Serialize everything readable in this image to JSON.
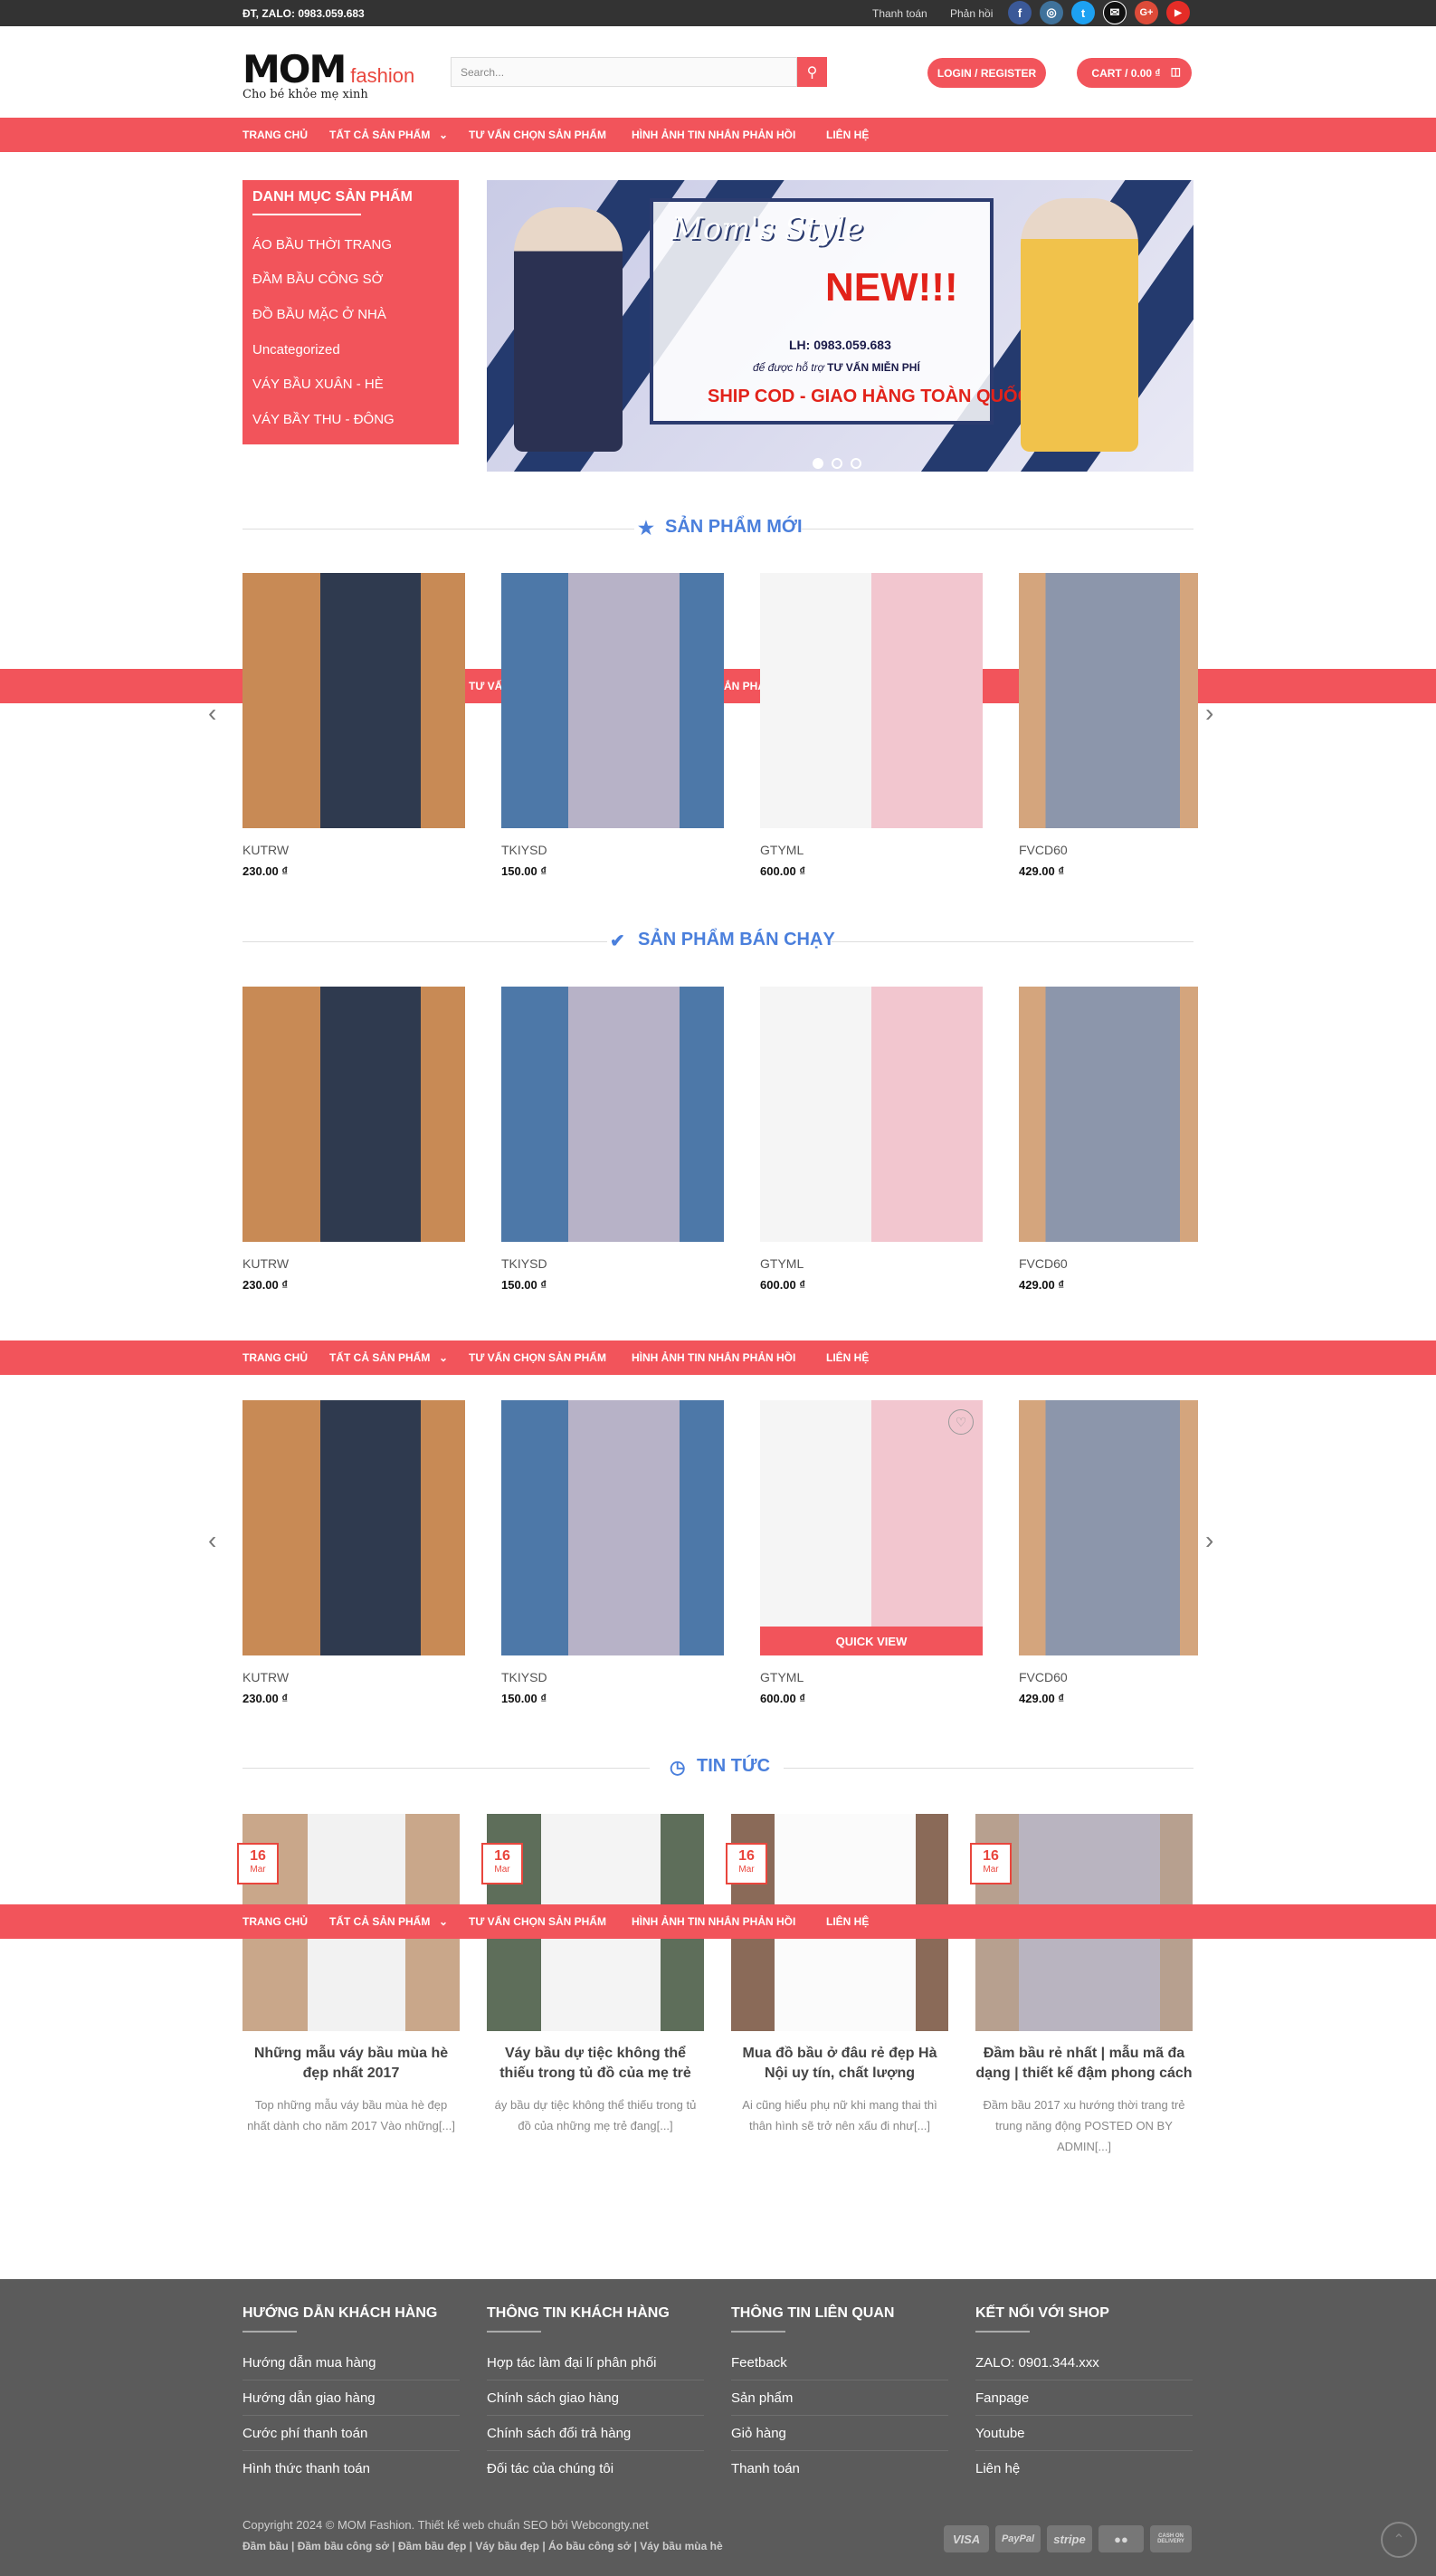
{
  "topbar": {
    "contact": "ĐT, ZALO: 0983.059.683",
    "links": [
      "Thanh toán",
      "Phản hồi"
    ]
  },
  "social": {
    "icons": [
      "facebook-icon",
      "instagram-icon",
      "twitter-icon",
      "email-icon",
      "google-plus-icon",
      "youtube-icon"
    ],
    "glyphs": [
      "f",
      "◎",
      "t",
      "✉",
      "G+",
      "▶"
    ],
    "colors": [
      "#3b5998",
      "#3f729b",
      "#1da1f2",
      "#111111",
      "#dd4b39",
      "#e52d27"
    ]
  },
  "logo": {
    "main": "MOM",
    "sub": "fashion",
    "tagline": "Cho bé khỏe mẹ xinh"
  },
  "search": {
    "placeholder": "Search..."
  },
  "header": {
    "login": "LOGIN / REGISTER",
    "cart": "CART / 0.00 ₫"
  },
  "nav": [
    "TRANG CHỦ",
    "TẤT CẢ SẢN PHẨM",
    "TƯ VẤN CHỌN SẢN PHẨM",
    "HÌNH ẢNH TIN NHẮN PHẢN HỒI",
    "LIÊN HỆ"
  ],
  "categories": {
    "title": "DANH MỤC SẢN PHẨM",
    "items": [
      "ÁO BẦU THỜI TRANG",
      "ĐẦM BẦU CÔNG SỞ",
      "ĐỒ BẦU MẶC Ở NHÀ",
      "Uncategorized",
      "VÁY BẦU XUÂN - HÈ",
      "VÁY BẦY THU - ĐÔNG"
    ]
  },
  "banner": {
    "title": "Mom's Style",
    "new": "NEW!!!",
    "phone": "LH: 0983.059.683",
    "advice_prefix": "để được hỗ trợ",
    "advice": "TƯ VẤN MIỄN PHÍ",
    "ship": "SHIP COD - GIAO HÀNG TOÀN QUỐC"
  },
  "sections": {
    "new": "SẢN PHẨM MỚI",
    "best": "SẢN PHẨM BÁN CHẠY",
    "news": "TIN TỨC"
  },
  "products": [
    {
      "name": "KUTRW",
      "price": "230.00 ₫"
    },
    {
      "name": "TKIYSD",
      "price": "150.00 ₫"
    },
    {
      "name": "GTYML",
      "price": "600.00 ₫"
    },
    {
      "name": "FVCD60",
      "price": "429.00 ₫"
    }
  ],
  "quick_view": "QUICK VIEW",
  "news": [
    {
      "day": "16",
      "month": "Mar",
      "title": "Những mẫu váy bầu mùa hè đẹp nhất 2017",
      "excerpt": "Top những mẫu váy bầu mùa hè đẹp nhất dành cho năm 2017 Vào những[...]"
    },
    {
      "day": "16",
      "month": "Mar",
      "title": "Váy bầu dự tiệc không thể thiếu trong tủ đồ của mẹ trẻ",
      "excerpt": "áy bầu dự tiệc không thể thiếu trong tủ đồ của những mẹ trẻ đang[...]"
    },
    {
      "day": "16",
      "month": "Mar",
      "title": "Mua đồ bầu ở đâu rẻ đẹp Hà Nội uy tín, chất lượng",
      "excerpt": "Ai cũng hiểu phụ nữ khi mang thai thì thân hình sẽ trở nên xấu đi như[...]"
    },
    {
      "day": "16",
      "month": "Mar",
      "title": "Đầm bầu rẻ nhất | mẫu mã đa dạng | thiết kế đậm phong cách",
      "excerpt": "Đầm bầu 2017 xu hướng thời trang trẻ trung năng động POSTED ON BY ADMIN[...]"
    }
  ],
  "footer": {
    "cols": [
      {
        "title": "HƯỚNG DẪN KHÁCH HÀNG",
        "links": [
          "Hướng dẫn mua hàng",
          "Hướng dẫn giao hàng",
          "Cước phí thanh toán",
          "Hình thức thanh toán"
        ]
      },
      {
        "title": "THÔNG TIN KHÁCH HÀNG",
        "links": [
          "Hợp tác làm đại lí phân phối",
          "Chính sách giao hàng",
          "Chính sách đổi trả hàng",
          "Đối tác của chúng tôi"
        ]
      },
      {
        "title": "THÔNG TIN LIÊN QUAN",
        "links": [
          "Feetback",
          "Sản phẩm",
          "Giỏ hàng",
          "Thanh toán"
        ]
      },
      {
        "title": "KẾT NỐI VỚI SHOP",
        "links": [
          "ZALO: 0901.344.xxx",
          "Fanpage",
          "Youtube",
          "Liên hệ"
        ]
      }
    ],
    "copyright": "Copyright 2024 © MOM Fashion. Thiết kế web chuẩn SEO bởi Webcongty.net",
    "keywords": "Đầm bầu | Đầm bầu công sở | Đầm bầu đẹp | Váy bầu đẹp | Áo bầu công sở | Váy bầu mùa hè",
    "payments": [
      "VISA",
      "PayPal",
      "stripe",
      "●●",
      "CASH ON DELIVERY"
    ]
  },
  "colors": {
    "accent": "#f2545b",
    "title_blue": "#4a7fdc",
    "footer": "#5b5b5b",
    "topbar": "#333333"
  }
}
